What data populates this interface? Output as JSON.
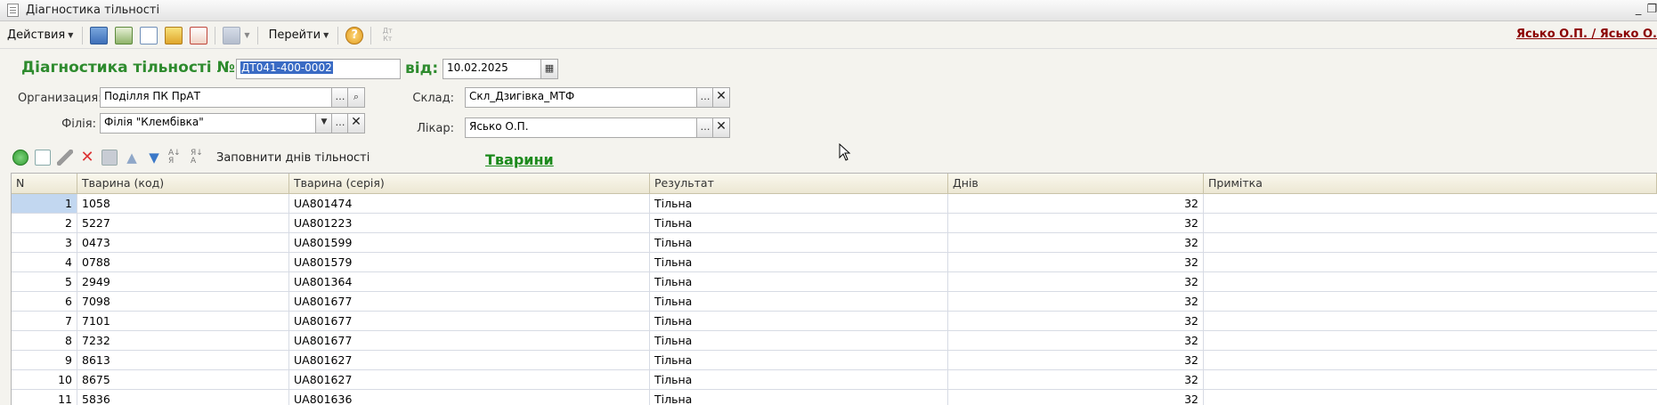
{
  "window": {
    "title": "Діагностика тільності",
    "controls": [
      "_",
      "❐"
    ]
  },
  "toolbar": {
    "actions_label": "Действия",
    "goto_label": "Перейти",
    "help_label": "?",
    "dt_kt_label": "Дт Кт",
    "user_label": "Ясько О.П. / Ясько О."
  },
  "header": {
    "doc_title": "Діагностика тільності №",
    "doc_number": "ДТ041-400-0002",
    "date_label": "від:",
    "date_value": "10.02.2025",
    "org_label": "Организация:",
    "org_value": "Поділля ПК ПрАТ",
    "branch_label": "Філія:",
    "branch_value": "Філія \"Клембівка\"",
    "warehouse_label": "Склад:",
    "warehouse_value": "Скл_Дзигівка_МТФ",
    "doctor_label": "Лікар:",
    "doctor_value": "Ясько О.П."
  },
  "table_toolbar": {
    "fill_days_label": "Заповнити днів тільності"
  },
  "tab_title": "Тварини",
  "table": {
    "columns": [
      "N",
      "Тварина (код)",
      "Тварина (серія)",
      "Результат",
      "Днів",
      "Примітка"
    ],
    "rows": [
      {
        "n": "1",
        "code": "1058",
        "series": "UA801474",
        "result": "Тільна",
        "days": "32",
        "note": ""
      },
      {
        "n": "2",
        "code": "5227",
        "series": "UA801223",
        "result": "Тільна",
        "days": "32",
        "note": ""
      },
      {
        "n": "3",
        "code": "0473",
        "series": "UA801599",
        "result": "Тільна",
        "days": "32",
        "note": ""
      },
      {
        "n": "4",
        "code": "0788",
        "series": "UA801579",
        "result": "Тільна",
        "days": "32",
        "note": ""
      },
      {
        "n": "5",
        "code": "2949",
        "series": "UA801364",
        "result": "Тільна",
        "days": "32",
        "note": ""
      },
      {
        "n": "6",
        "code": "7098",
        "series": "UA801677",
        "result": "Тільна",
        "days": "32",
        "note": ""
      },
      {
        "n": "7",
        "code": "7101",
        "series": "UA801677",
        "result": "Тільна",
        "days": "32",
        "note": ""
      },
      {
        "n": "8",
        "code": "7232",
        "series": "UA801677",
        "result": "Тільна",
        "days": "32",
        "note": ""
      },
      {
        "n": "9",
        "code": "8613",
        "series": "UA801627",
        "result": "Тільна",
        "days": "32",
        "note": ""
      },
      {
        "n": "10",
        "code": "8675",
        "series": "UA801627",
        "result": "Тільна",
        "days": "32",
        "note": ""
      },
      {
        "n": "11",
        "code": "5836",
        "series": "UA801636",
        "result": "Тільна",
        "days": "32",
        "note": ""
      }
    ]
  }
}
